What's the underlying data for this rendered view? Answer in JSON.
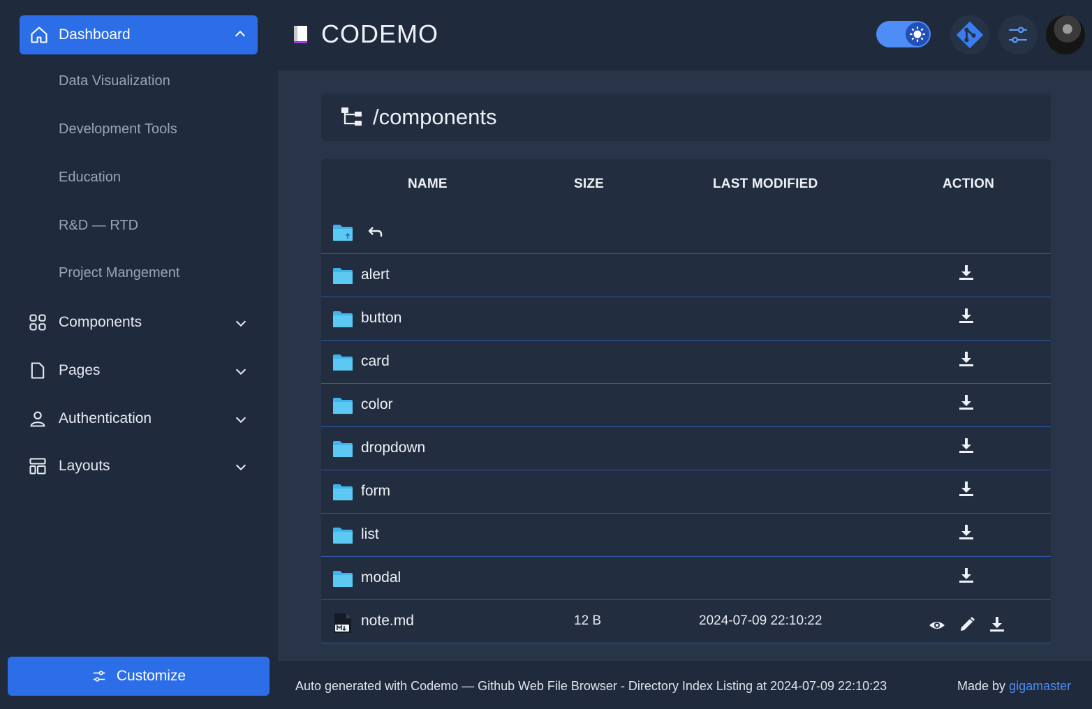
{
  "sidebar": {
    "active": {
      "label": "Dashboard"
    },
    "sub_items": [
      "Data Visualization",
      "Development Tools",
      "Education",
      "R&D — RTD",
      "Project Mangement"
    ],
    "items": [
      {
        "label": "Components",
        "icon": "grid-icon"
      },
      {
        "label": "Pages",
        "icon": "page-icon"
      },
      {
        "label": "Authentication",
        "icon": "user-icon"
      },
      {
        "label": "Layouts",
        "icon": "layout-icon"
      }
    ],
    "customize_label": "Customize"
  },
  "header": {
    "brand": "CODEMO",
    "icons": [
      "book-icon",
      "theme-toggle-sun-icon",
      "git-icon",
      "sliders-icon",
      "avatar"
    ]
  },
  "path": "/components",
  "table": {
    "columns": [
      "NAME",
      "SIZE",
      "LAST MODIFIED",
      "ACTION"
    ],
    "rows": [
      {
        "name": "alert"
      },
      {
        "name": "button"
      },
      {
        "name": "card"
      },
      {
        "name": "color"
      },
      {
        "name": "dropdown"
      },
      {
        "name": "form"
      },
      {
        "name": "list"
      },
      {
        "name": "modal"
      }
    ],
    "file": {
      "name": "note.md",
      "size": "12 B",
      "modified": "2024-07-09 22:10:22"
    }
  },
  "footer": {
    "text": "Auto generated with Codemo — Github Web File Browser - Directory Index Listing at 2024-07-09 22:10:23",
    "made_by": "Made by",
    "author": "gigamaster"
  },
  "colors": {
    "accent": "#2b6ee8",
    "folder": "#3fb5ec",
    "link": "#4e8cf6"
  }
}
